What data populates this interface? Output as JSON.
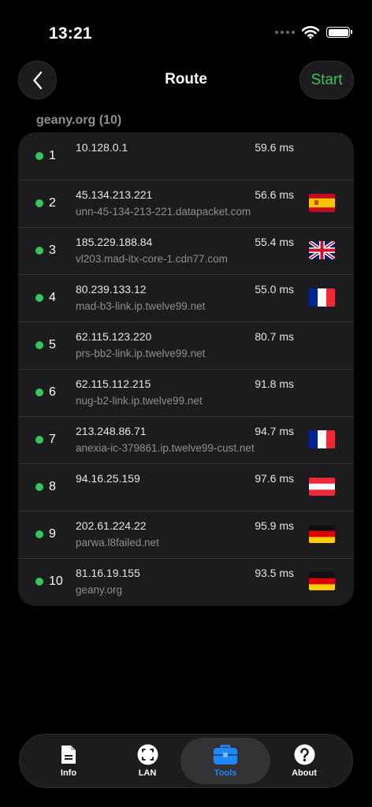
{
  "status": {
    "time": "13:21"
  },
  "nav": {
    "title": "Route",
    "start_label": "Start"
  },
  "section": {
    "title": "geany.org (10)"
  },
  "hops": [
    {
      "index": "1",
      "ip": "10.128.0.1",
      "host": "",
      "ms": "59.6 ms",
      "flag": "none"
    },
    {
      "index": "2",
      "ip": "45.134.213.221",
      "host": "unn-45-134-213-221.datapacket.com",
      "ms": "56.6 ms",
      "flag": "spain"
    },
    {
      "index": "3",
      "ip": "185.229.188.84",
      "host": "vl203.mad-itx-core-1.cdn77.com",
      "ms": "55.4 ms",
      "flag": "uk"
    },
    {
      "index": "4",
      "ip": "80.239.133.12",
      "host": "mad-b3-link.ip.twelve99.net",
      "ms": "55.0 ms",
      "flag": "france"
    },
    {
      "index": "5",
      "ip": "62.115.123.220",
      "host": "prs-bb2-link.ip.twelve99.net",
      "ms": "80.7 ms",
      "flag": "none"
    },
    {
      "index": "6",
      "ip": "62.115.112.215",
      "host": "nug-b2-link.ip.twelve99.net",
      "ms": "91.8 ms",
      "flag": "none"
    },
    {
      "index": "7",
      "ip": "213.248.86.71",
      "host": "anexia-ic-379861.ip.twelve99-cust.net",
      "ms": "94.7 ms",
      "flag": "france"
    },
    {
      "index": "8",
      "ip": "94.16.25.159",
      "host": "",
      "ms": "97.6 ms",
      "flag": "austria"
    },
    {
      "index": "9",
      "ip": "202.61.224.22",
      "host": "parwa.l8failed.net",
      "ms": "95.9 ms",
      "flag": "germany"
    },
    {
      "index": "10",
      "ip": "81.16.19.155",
      "host": "geany.org",
      "ms": "93.5 ms",
      "flag": "germany"
    }
  ],
  "colors": {
    "accent_green": "#34c759",
    "accent_blue": "#1e88ff",
    "card": "#1c1c1e"
  },
  "tabs": [
    {
      "label": "Info",
      "icon": "document-icon",
      "active": false
    },
    {
      "label": "LAN",
      "icon": "scan-icon",
      "active": false
    },
    {
      "label": "Tools",
      "icon": "toolbox-icon",
      "active": true
    },
    {
      "label": "About",
      "icon": "question-icon",
      "active": false
    }
  ]
}
